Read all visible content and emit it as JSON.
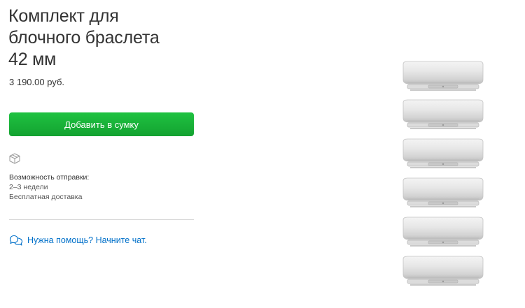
{
  "product": {
    "title_lines": [
      "Комплект для",
      "блочного браслета",
      "42 мм"
    ],
    "price": "3 190.00 руб."
  },
  "actions": {
    "add_to_bag_label": "Добавить в сумку"
  },
  "shipping": {
    "icon": "box-icon",
    "label": "Возможность отправки:",
    "time": "2–3 недели",
    "delivery": "Бесплатная доставка"
  },
  "help": {
    "icon": "chat-bubbles-icon",
    "chat_link": "Нужна помощь? Начните чат."
  },
  "colors": {
    "button_green": "#1aaf37",
    "link_blue": "#0070c9",
    "divider": "#d6d6d6"
  }
}
